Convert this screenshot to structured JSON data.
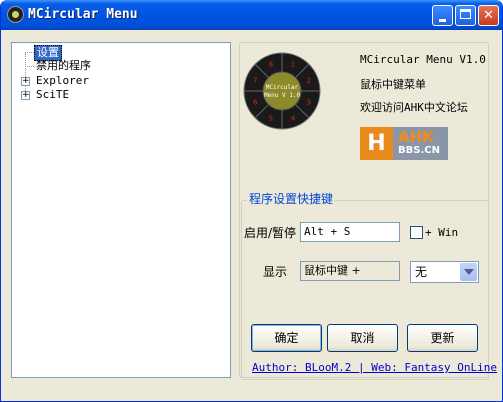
{
  "window": {
    "title": "MCircular Menu",
    "controls": {
      "minimize_icon": "minimize-icon",
      "maximize_icon": "maximize-icon",
      "close_icon": "close-icon",
      "close_glyph": "✕"
    }
  },
  "tree": {
    "items": [
      {
        "label": "设置",
        "selected": true,
        "expandable": false
      },
      {
        "label": "禁用的程序",
        "selected": false,
        "expandable": false
      },
      {
        "label": "Explorer",
        "selected": false,
        "expandable": true
      },
      {
        "label": "SciTE",
        "selected": false,
        "expandable": true
      }
    ],
    "expander_glyph": "+"
  },
  "about": {
    "ring_center_line1": "MCircular",
    "ring_center_line2": "Menu V 1.0",
    "ring_numbers": [
      "1",
      "2",
      "3",
      "4",
      "5",
      "6",
      "7",
      "8"
    ],
    "app_name": "MCircular Menu V1.0",
    "menu_desc": "鼠标中键菜单",
    "forum_text": "欢迎访问AHK中文论坛",
    "logo_h": "H",
    "logo_ahk": "AHK",
    "logo_bds": "BBS.CN"
  },
  "hotkeys": {
    "group_title": "程序设置快捷键",
    "toggle_label": "启用/暂停",
    "toggle_value": "Alt + S",
    "win_label": "+ Win",
    "win_checked": false,
    "show_label": "显示",
    "show_value": "鼠标中键 +",
    "modifier_value": "无"
  },
  "buttons": {
    "ok": "确定",
    "cancel": "取消",
    "update": "更新"
  },
  "footer_link": "Author: BLooM.2 | Web: Fantasy OnLine",
  "colors": {
    "titlebar": "#0054e3",
    "selection": "#316ac5",
    "group_title": "#0046d5",
    "link": "#0000cc",
    "logo_orange": "#e88a1c"
  }
}
